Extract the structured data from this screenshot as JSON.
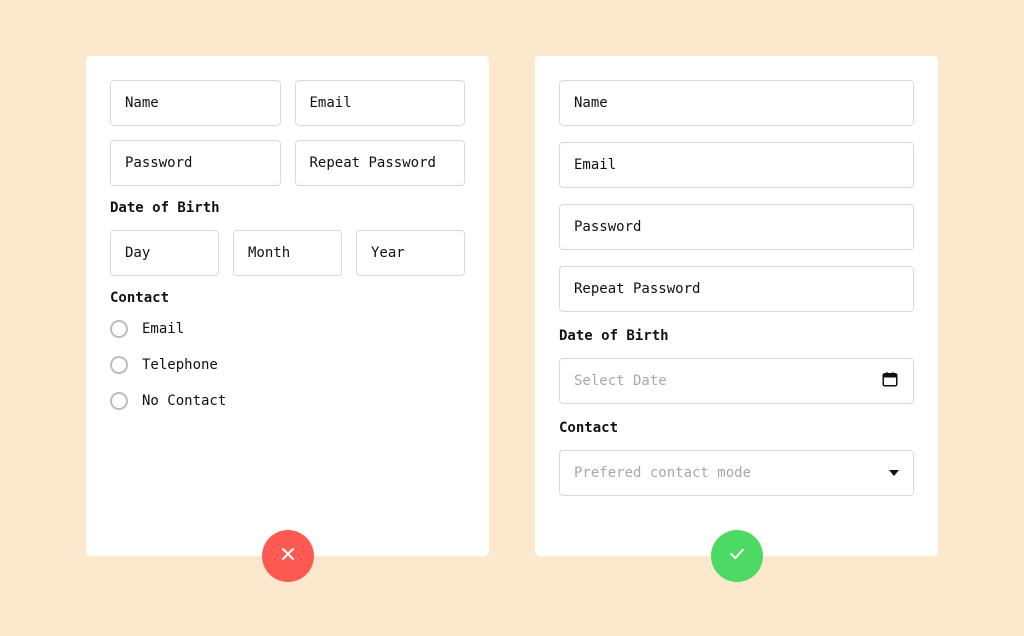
{
  "left": {
    "fields": {
      "name": "Name",
      "email": "Email",
      "password": "Password",
      "repeat_password": "Repeat Password"
    },
    "dob": {
      "label": "Date of Birth",
      "day": "Day",
      "month": "Month",
      "year": "Year"
    },
    "contact": {
      "label": "Contact",
      "options": {
        "email": "Email",
        "telephone": "Telephone",
        "no_contact": "No Contact"
      }
    }
  },
  "right": {
    "fields": {
      "name": "Name",
      "email": "Email",
      "password": "Password",
      "repeat_password": "Repeat Password"
    },
    "dob": {
      "label": "Date of Birth",
      "placeholder": "Select Date"
    },
    "contact": {
      "label": "Contact",
      "placeholder": "Prefered contact mode"
    }
  }
}
